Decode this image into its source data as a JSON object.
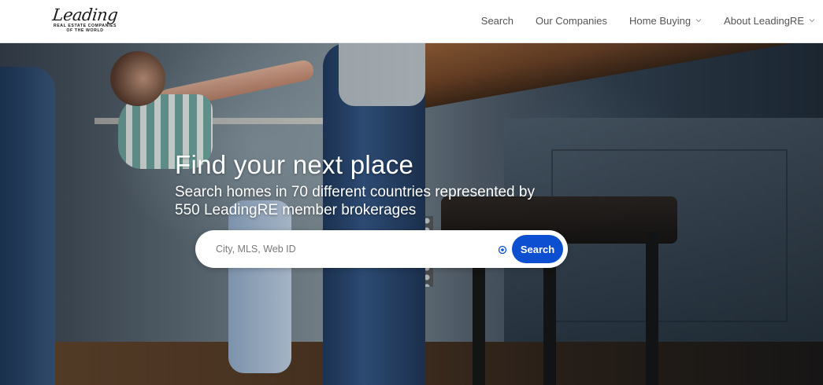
{
  "brand": {
    "logo_script": "Leading",
    "logo_line1": "REAL ESTATE COMPANIES",
    "logo_line2": "OF THE WORLD"
  },
  "nav": {
    "items": [
      {
        "label": "Search",
        "has_dropdown": false
      },
      {
        "label": "Our Companies",
        "has_dropdown": false
      },
      {
        "label": "Home Buying",
        "has_dropdown": true
      },
      {
        "label": "About LeadingRE",
        "has_dropdown": true
      }
    ]
  },
  "hero": {
    "title": "Find your next place",
    "subtitle": "Search homes in 70 different countries represented by 550 LeadingRE member brokerages"
  },
  "search": {
    "placeholder": "City, MLS, Web ID",
    "value": "",
    "button_label": "Search",
    "locate_icon": "target-icon"
  },
  "colors": {
    "accent": "#0c4fd1",
    "nav_text": "#555555",
    "hero_text": "#ffffff"
  }
}
